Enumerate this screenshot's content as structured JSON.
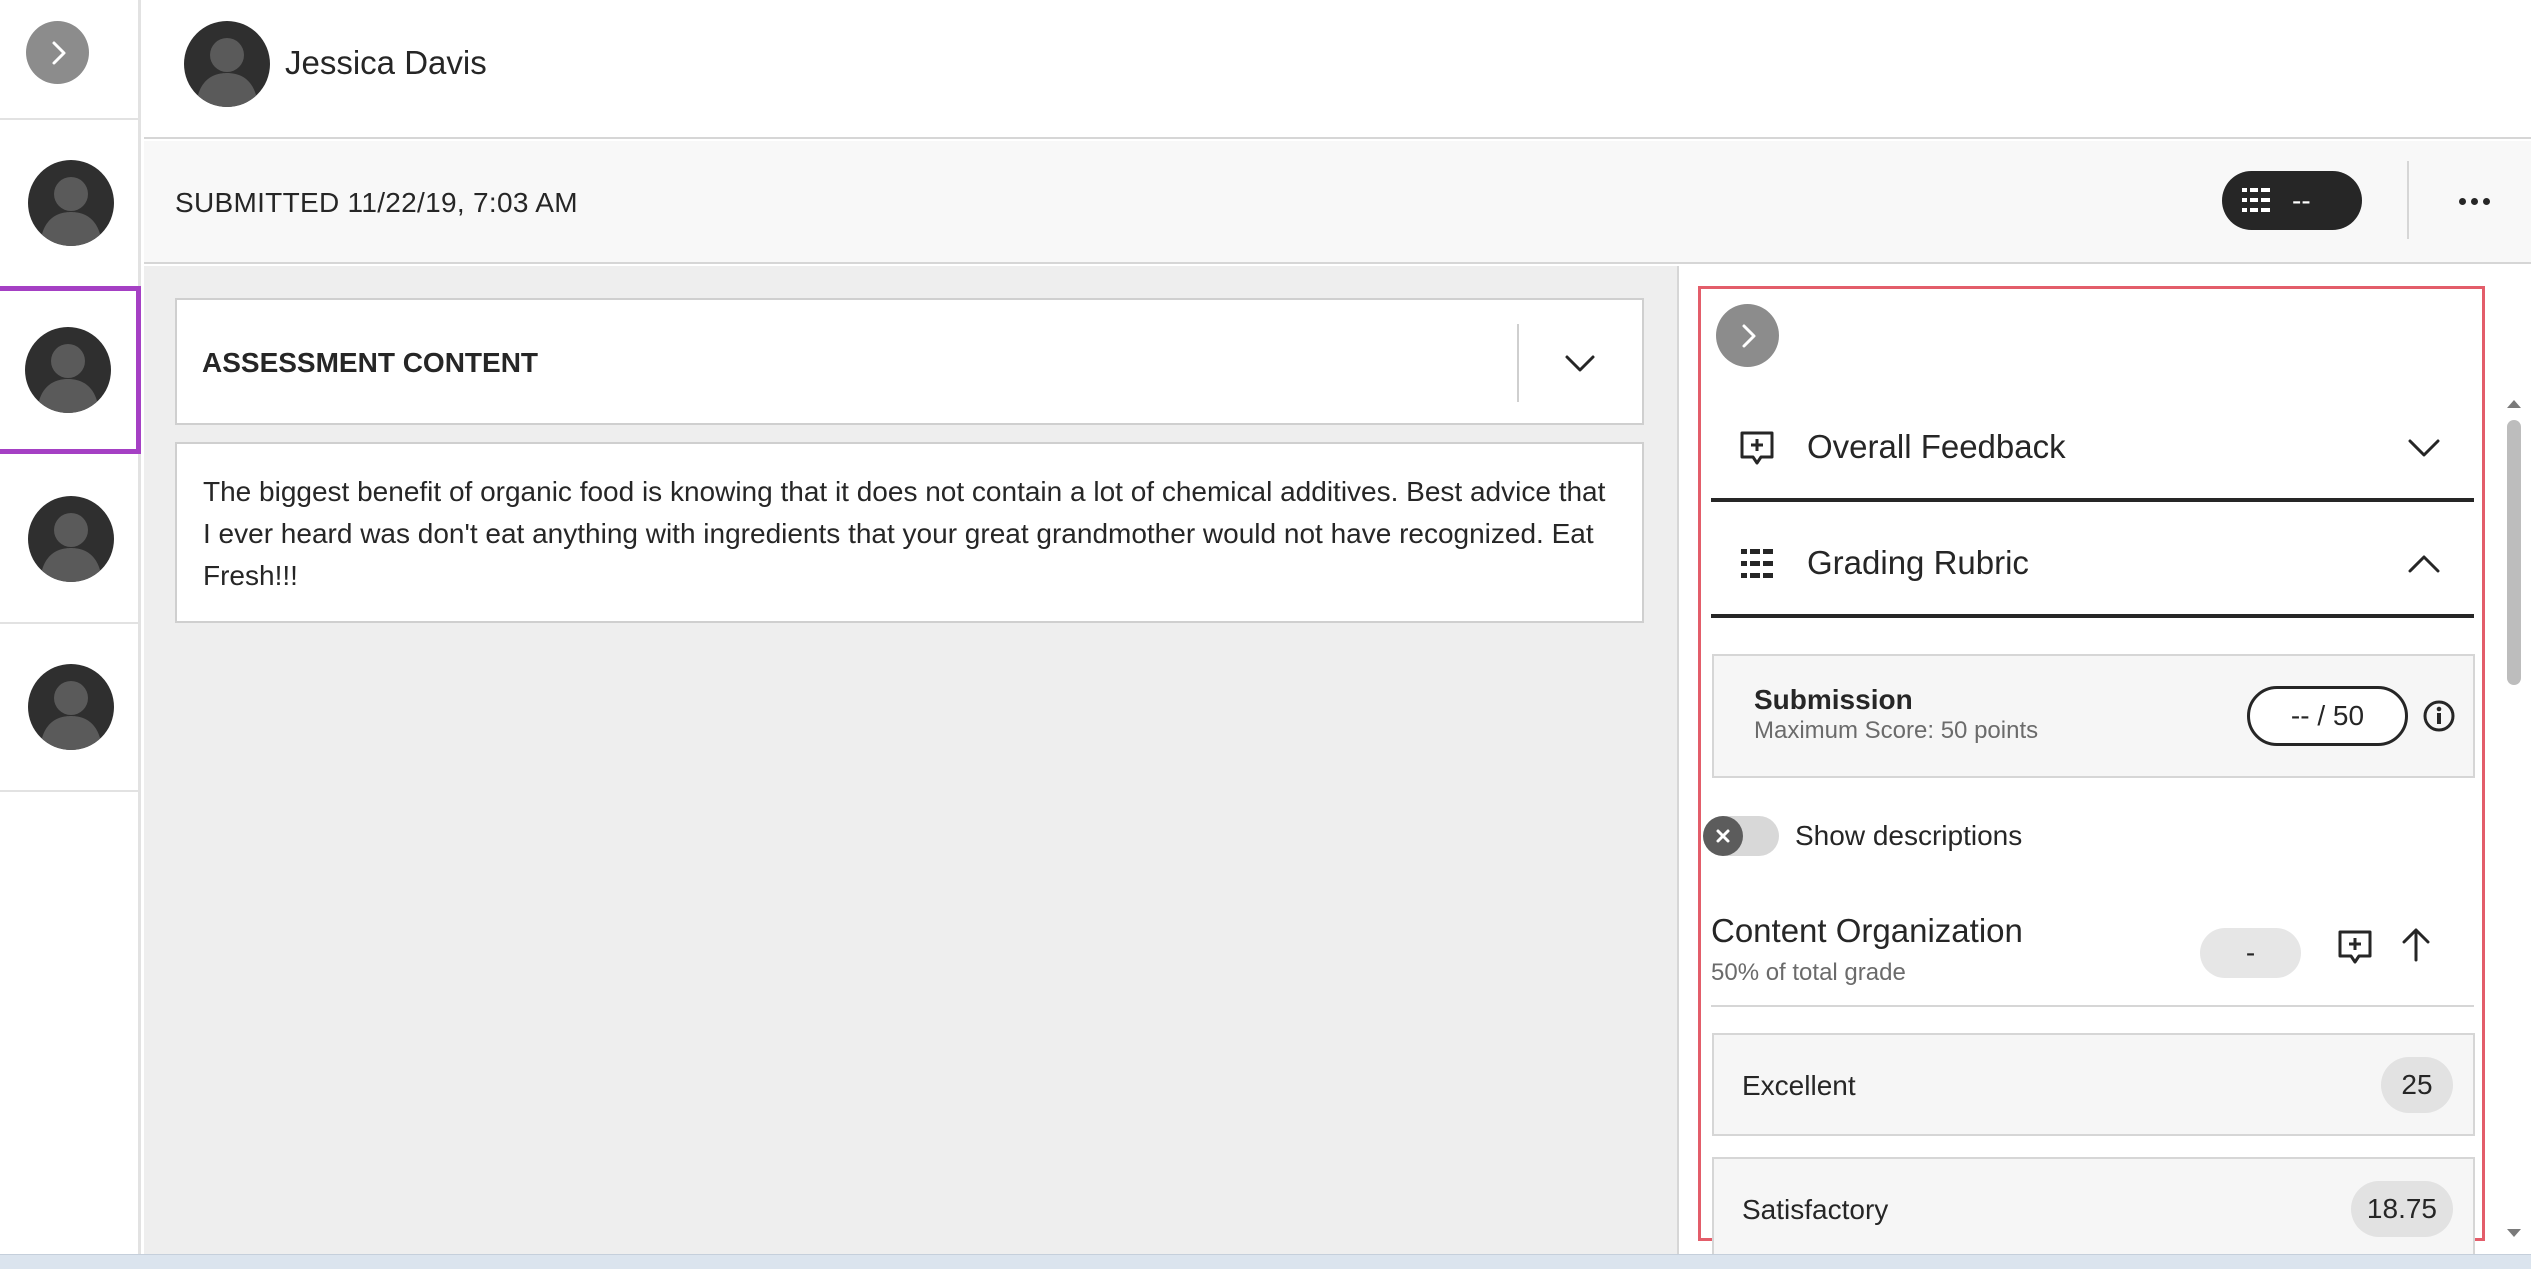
{
  "student": {
    "name": "Jessica Davis"
  },
  "submission": {
    "submitted_text": "SUBMITTED 11/22/19, 7:03 AM"
  },
  "grade_pill": {
    "value": "--"
  },
  "assessment": {
    "title": "ASSESSMENT CONTENT",
    "body": "The biggest benefit of organic food is knowing that it does not contain a lot of chemical additives. Best advice that I ever heard was don't eat anything with ingredients that your great grandmother would not have recognized. Eat Fresh!!!"
  },
  "panel": {
    "sections": [
      {
        "label": "Overall Feedback",
        "icon": "feedback-plus-icon",
        "expanded": false
      },
      {
        "label": "Grading Rubric",
        "icon": "rubric-icon",
        "expanded": true
      }
    ],
    "submission_card": {
      "title": "Submission",
      "subtitle": "Maximum Score: 50 points",
      "score": "-- / 50"
    },
    "show_descriptions": {
      "label": "Show descriptions",
      "on": false
    },
    "criterion": {
      "title": "Content Organization",
      "subtitle": "50% of total grade",
      "score": "-"
    },
    "levels": [
      {
        "label": "Excellent",
        "points": "25"
      },
      {
        "label": "Satisfactory",
        "points": "18.75"
      }
    ]
  },
  "colors": {
    "selected_accent": "#a540c4",
    "highlight_outline": "#e35d6a",
    "dark": "#262626",
    "avatar_bg": "#2f2f2f"
  }
}
